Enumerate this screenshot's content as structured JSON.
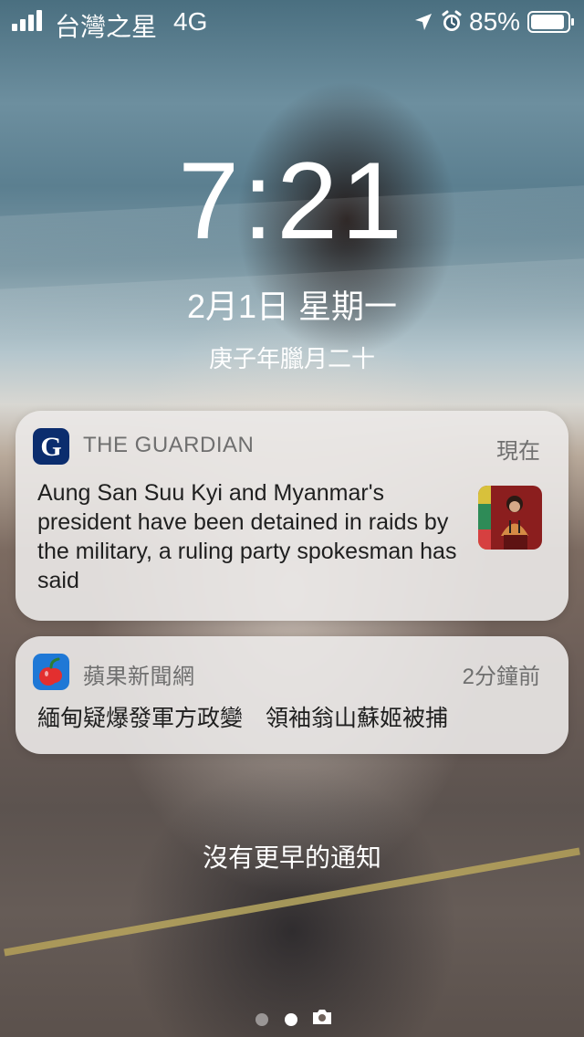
{
  "status_bar": {
    "carrier": "台灣之星",
    "network": "4G",
    "battery_percent": "85%",
    "icons": [
      "signal-icon",
      "location-icon",
      "alarm-icon",
      "battery-icon"
    ]
  },
  "lock_screen": {
    "time": "7:21",
    "date": "2月1日 星期一",
    "lunar_date": "庚子年臘月二十",
    "no_earlier_notifications": "沒有更早的通知"
  },
  "notifications": [
    {
      "app_name": "THE GUARDIAN",
      "time": "現在",
      "body": "Aung San Suu Kyi and Myanmar's president have been detained in raids by the military, a ruling party spokesman has said",
      "icon": "guardian-icon",
      "icon_letter": "G",
      "thumbnail": "news-thumbnail-image"
    },
    {
      "app_name": "蘋果新聞網",
      "time": "2分鐘前",
      "body": "緬甸疑爆發軍方政變　領袖翁山蘇姬被捕",
      "icon": "apple-icon"
    }
  ],
  "colors": {
    "notification_background": "#ebe9e8",
    "notification_text": "#1f1f1f",
    "secondary_text": "#6f6f6f",
    "guardian_blue": "#0b2d6e",
    "apple_blue": "#1f78d6",
    "apple_red": "#e32f2f"
  },
  "page_indicator": {
    "active_index": 1,
    "icons": [
      "page-dot-icon",
      "page-dot-icon",
      "camera-icon"
    ]
  }
}
